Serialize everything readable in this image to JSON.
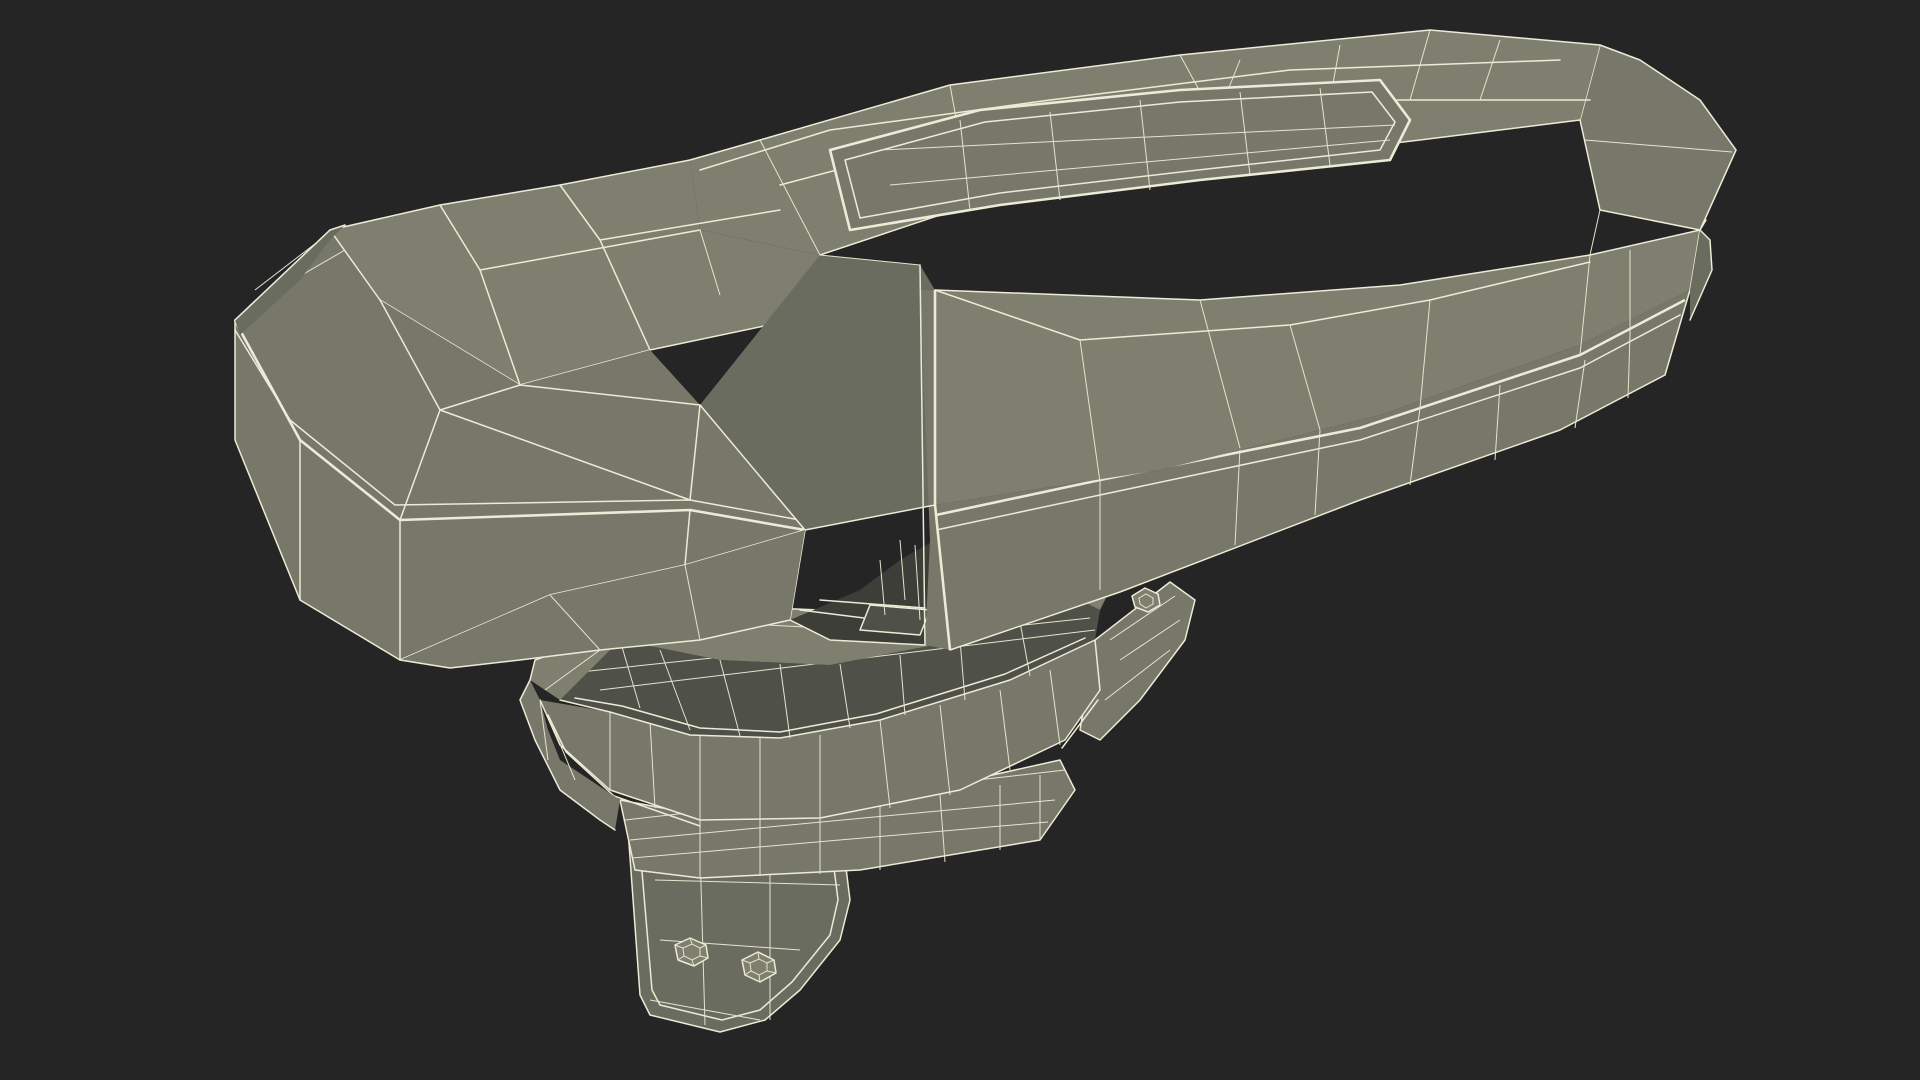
{
  "viewport": {
    "background_color": "#252525"
  },
  "model": {
    "render_mode": "wireframe-on-shaded",
    "surface_color": "#787968",
    "wire_color": "#ecebd6",
    "parts": [
      "housing",
      "mount-base",
      "mount-bracket",
      "bolt-heads"
    ]
  }
}
